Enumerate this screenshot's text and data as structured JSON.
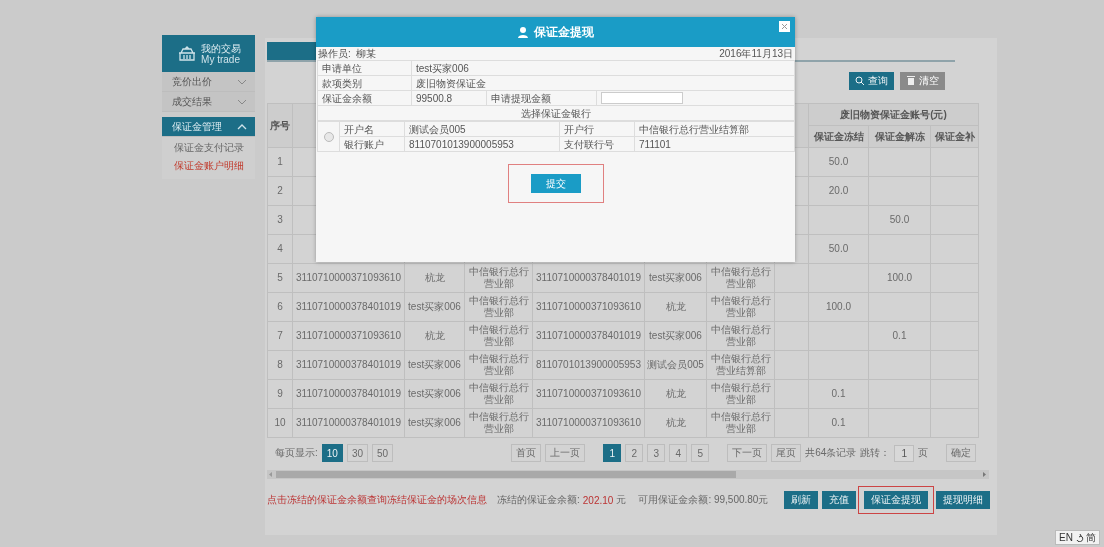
{
  "sidebar": {
    "title": "我的交易",
    "subtitle": "My trade",
    "items": [
      {
        "label": "竞价出价",
        "expanded": false
      },
      {
        "label": "成交结果",
        "expanded": false
      },
      {
        "label": "保证金管理",
        "expanded": true,
        "children": [
          {
            "label": "保证金支付记录",
            "selected": false
          },
          {
            "label": "保证金账户明细",
            "selected": true
          }
        ]
      }
    ]
  },
  "panel": {
    "search_buttons": [
      {
        "label": "查询",
        "kind": "search"
      },
      {
        "label": "清空",
        "kind": "clear"
      }
    ],
    "table": {
      "index_label": "序号",
      "group_label": "废旧物资保证金账号(元)",
      "group_columns": [
        "保证金冻结",
        "保证金解冻",
        "保证金补"
      ],
      "rows": [
        {
          "cells": [
            "1",
            null,
            null,
            null,
            null,
            null,
            null,
            null,
            "50.0",
            null,
            null
          ]
        },
        {
          "cells": [
            "2",
            null,
            null,
            null,
            null,
            null,
            null,
            null,
            "20.0",
            null,
            null
          ]
        },
        {
          "cells": [
            "3",
            null,
            null,
            null,
            null,
            null,
            null,
            null,
            null,
            "50.0",
            null
          ]
        },
        {
          "cells": [
            "4",
            null,
            null,
            null,
            null,
            null,
            null,
            null,
            "50.0",
            null,
            null
          ]
        },
        {
          "cells": [
            "5",
            "3110710000371093610",
            "杭龙",
            "中信银行总行营业部",
            "3110710000378401019",
            "test买家006",
            "中信银行总行营业部",
            null,
            null,
            "100.0",
            null
          ]
        },
        {
          "cells": [
            "6",
            "3110710000378401019",
            "test买家006",
            "中信银行总行营业部",
            "3110710000371093610",
            "杭龙",
            "中信银行总行营业部",
            null,
            "100.0",
            null,
            null
          ]
        },
        {
          "cells": [
            "7",
            "3110710000371093610",
            "杭龙",
            "中信银行总行营业部",
            "3110710000378401019",
            "test买家006",
            "中信银行总行营业部",
            null,
            null,
            "0.1",
            null
          ]
        },
        {
          "cells": [
            "8",
            "3110710000378401019",
            "test买家006",
            "中信银行总行营业部",
            "8110701013900005953",
            "测试会员005",
            "中信银行总行营业结算部",
            null,
            null,
            null,
            null
          ]
        },
        {
          "cells": [
            "9",
            "3110710000378401019",
            "test买家006",
            "中信银行总行营业部",
            "3110710000371093610",
            "杭龙",
            "中信银行总行营业部",
            null,
            "0.1",
            null,
            null
          ]
        },
        {
          "cells": [
            "10",
            "3110710000378401019",
            "test买家006",
            "中信银行总行营业部",
            "3110710000371093610",
            "杭龙",
            "中信银行总行营业部",
            null,
            "0.1",
            null,
            null
          ]
        }
      ]
    },
    "pagination": {
      "page_size_label": "每页显示:",
      "page_sizes": [
        {
          "label": "10",
          "selected": true
        },
        {
          "label": "30",
          "selected": false
        },
        {
          "label": "50",
          "selected": false
        }
      ],
      "first": "首页",
      "prev": "上一页",
      "pages": [
        {
          "label": "1",
          "selected": true
        },
        {
          "label": "2",
          "selected": false
        },
        {
          "label": "3",
          "selected": false
        },
        {
          "label": "4",
          "selected": false
        },
        {
          "label": "5",
          "selected": false
        }
      ],
      "next": "下一页",
      "last": "尾页",
      "total": "共64条记录",
      "jump_label": "跳转：",
      "jump_value": "1",
      "jump_unit": "页",
      "confirm": "确定"
    },
    "footer": {
      "hint": "点击冻结的保证金余额查询冻结保证金的场次信息",
      "frozen_label": "冻结的保证金余额:",
      "frozen_value": "202.10",
      "frozen_unit": "元",
      "available": "可用保证金余额: 99,500.80元",
      "buttons": [
        {
          "label": "刷新",
          "highlighted": false
        },
        {
          "label": "充值",
          "highlighted": false
        },
        {
          "label": "保证金提现",
          "highlighted": true
        },
        {
          "label": "提现明细",
          "highlighted": false
        }
      ]
    }
  },
  "dialog": {
    "title": "保证金提现",
    "operator_label": "操作员:",
    "operator": "柳某",
    "date": "2016年11月13日",
    "fields": [
      {
        "label": "申请单位",
        "value": "test买家006"
      },
      {
        "label": "款项类别",
        "value": "废旧物资保证金"
      }
    ],
    "balance": {
      "label": "保证金余额",
      "value": "99500.8",
      "amount_label": "申请提现金额"
    },
    "bank_section_title": "选择保证金银行",
    "banks": [
      {
        "selected": false,
        "rows": [
          [
            "开户名",
            "测试会员005",
            "开户行",
            "中信银行总行营业结算部"
          ],
          [
            "银行账户",
            "8110701013900005953",
            "支付联行号",
            "711101"
          ]
        ]
      }
    ],
    "submit": {
      "label": "提交",
      "highlighted": true
    }
  },
  "ime": {
    "left": "EN",
    "right": "简"
  }
}
